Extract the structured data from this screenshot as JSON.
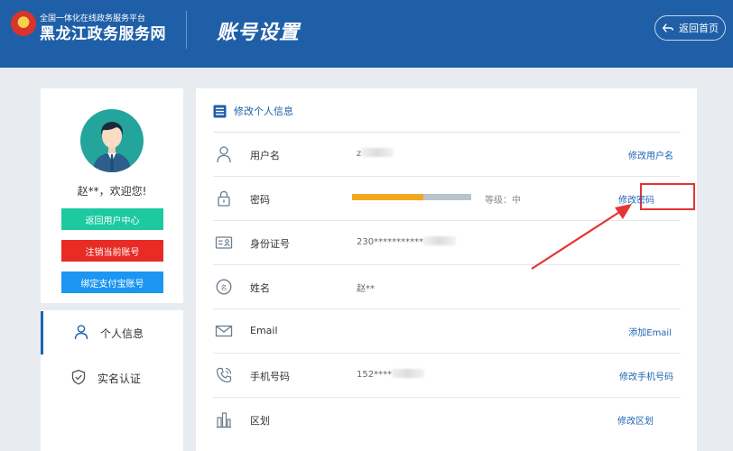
{
  "header": {
    "platform_name": "全国一体化在线政务服务平台",
    "site_name": "黑龙江政务服务网",
    "page_title": "账号设置",
    "back_home_label": "返回首页",
    "colors": {
      "header_bg": "#1f5fa8",
      "accent": "#1f63b3"
    }
  },
  "profile": {
    "greeting": "赵**，欢迎您!",
    "buttons": {
      "back_user_center": "返回用户中心",
      "cancel_account": "注销当前账号",
      "bind_alipay": "绑定支付宝账号"
    }
  },
  "nav": {
    "personal_info": "个人信息",
    "real_name_auth": "实名认证"
  },
  "main": {
    "section_title": "修改个人信息",
    "rows": [
      {
        "label": "用户名",
        "value": "z",
        "action": "修改用户名",
        "icon": "user-icon"
      },
      {
        "label": "密码",
        "value": "",
        "action": "修改密码",
        "icon": "lock-icon"
      },
      {
        "label": "身份证号",
        "value": "230***********",
        "action": "",
        "icon": "id-card-icon"
      },
      {
        "label": "姓名",
        "value": "赵**",
        "action": "",
        "icon": "name-icon"
      },
      {
        "label": "Email",
        "value": "",
        "action": "添加Email",
        "icon": "email-icon"
      },
      {
        "label": "手机号码",
        "value": "152****",
        "action": "修改手机号码",
        "icon": "phone-icon"
      },
      {
        "label": "区划",
        "value": "",
        "action": "修改区划",
        "icon": "region-icon"
      }
    ],
    "password_strength": {
      "label": "等级：中",
      "fraction": 0.6
    }
  }
}
